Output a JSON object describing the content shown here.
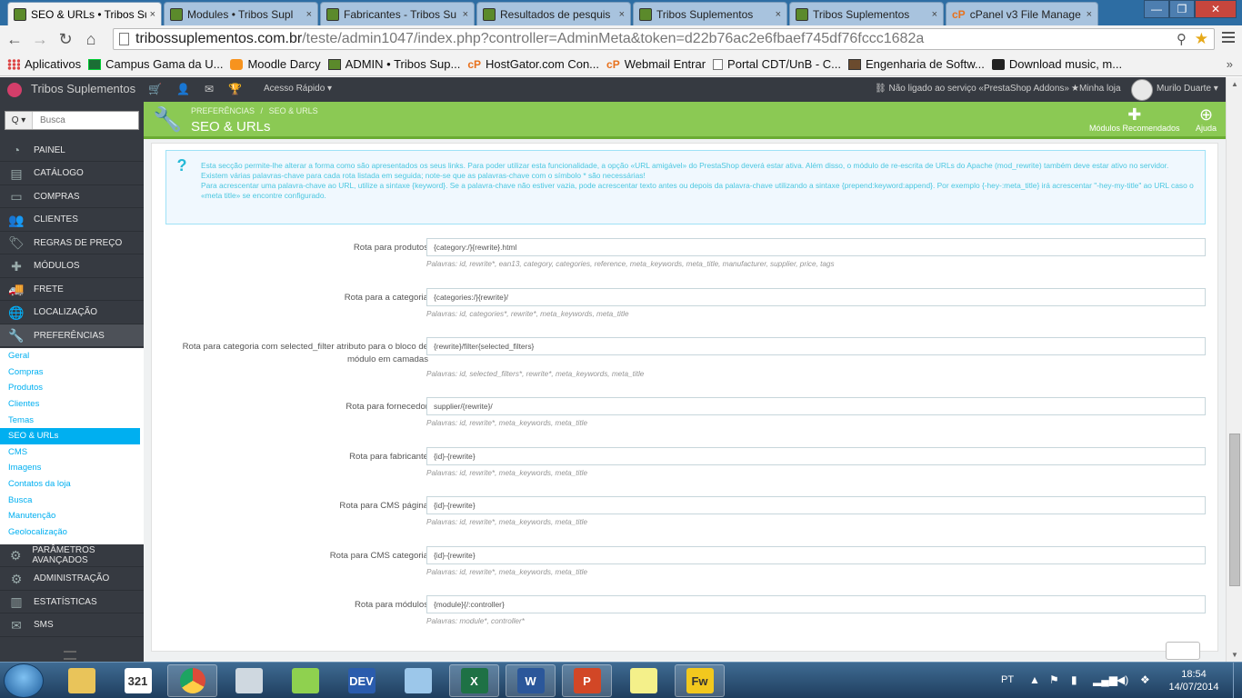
{
  "browser": {
    "tabs": [
      {
        "label": "SEO & URLs • Tribos Su",
        "active": true
      },
      {
        "label": "Modules • Tribos Supl"
      },
      {
        "label": "Fabricantes - Tribos Su"
      },
      {
        "label": "Resultados de pesquis"
      },
      {
        "label": "Tribos Suplementos"
      },
      {
        "label": "Tribos Suplementos"
      },
      {
        "label": "cPanel v3 File Manage"
      }
    ],
    "tab_close": "×",
    "window_controls": {
      "minimize": "—",
      "maximize": "❐",
      "close": "✕"
    },
    "url_host": "tribossuplementos.com.br",
    "url_path": "/teste/admin1047/index.php?controller=AdminMeta&token=d22b76ac2e6fbaef745df76fccc1682a",
    "bookmarks": [
      {
        "label": "Aplicativos",
        "icon": "apps-grid-icon"
      },
      {
        "label": "Campus Gama da U...",
        "icon": "flag-icon"
      },
      {
        "label": "Moodle Darcy",
        "icon": "moodle-icon"
      },
      {
        "label": "ADMIN • Tribos Sup...",
        "icon": "prestashop-icon"
      },
      {
        "label": "HostGator.com Con...",
        "icon": "cpanel-icon"
      },
      {
        "label": "Webmail Entrar",
        "icon": "cpanel-icon"
      },
      {
        "label": "Portal CDT/UnB - C...",
        "icon": "page-icon"
      },
      {
        "label": "Engenharia de Softw...",
        "icon": "image-icon"
      },
      {
        "label": "Download music, m...",
        "icon": "computer-icon"
      }
    ],
    "bookmarks_more": "»"
  },
  "ps_header": {
    "shop_name": "Tribos Suplementos",
    "quick_access": "Acesso Rápido ▾",
    "addons_status": "Não ligado ao serviço «PrestaShop Addons»",
    "my_store": "Minha loja",
    "user_name": "Murilo Duarte ▾"
  },
  "sidebar": {
    "search_placeholder": "Busca",
    "search_button": "Q ▾",
    "menu": [
      {
        "label": "PAINEL",
        "icon": "dashboard-icon"
      },
      {
        "label": "CATÁLOGO",
        "icon": "book-icon"
      },
      {
        "label": "COMPRAS",
        "icon": "credit-card-icon"
      },
      {
        "label": "CLIENTES",
        "icon": "users-icon"
      },
      {
        "label": "REGRAS DE PREÇO",
        "icon": "tag-icon"
      },
      {
        "label": "MÓDULOS",
        "icon": "puzzle-icon"
      },
      {
        "label": "FRETE",
        "icon": "truck-icon"
      },
      {
        "label": "LOCALIZAÇÃO",
        "icon": "globe-icon"
      },
      {
        "label": "PREFERÊNCIAS",
        "icon": "wrench-icon",
        "active": true
      }
    ],
    "submenu": [
      {
        "label": "Geral"
      },
      {
        "label": "Compras"
      },
      {
        "label": "Produtos"
      },
      {
        "label": "Clientes"
      },
      {
        "label": "Temas"
      },
      {
        "label": "SEO & URLs",
        "active": true
      },
      {
        "label": "CMS"
      },
      {
        "label": "Imagens"
      },
      {
        "label": "Contatos da loja"
      },
      {
        "label": "Busca"
      },
      {
        "label": "Manutenção"
      },
      {
        "label": "Geolocalização"
      }
    ],
    "menu_bottom": [
      {
        "label": "PARÂMETROS AVANÇADOS",
        "icon": "cogs-icon"
      },
      {
        "label": "ADMINISTRAÇÃO",
        "icon": "gear-icon"
      },
      {
        "label": "ESTATÍSTICAS",
        "icon": "bar-chart-icon"
      },
      {
        "label": "SMS",
        "icon": "envelope-icon"
      }
    ]
  },
  "page": {
    "breadcrumb_1": "PREFERÊNCIAS",
    "breadcrumb_2": "SEO & URLS",
    "title": "SEO & URLs",
    "recommended_modules": "Módulos Recomendados",
    "help": "Ajuda"
  },
  "alert": {
    "line1": "Esta secção permite-lhe alterar a forma como são apresentados os seus links. Para poder utilizar esta funcionalidade, a opção «URL amigável» do PrestaShop deverá estar ativa. Além disso, o módulo de re-escrita de URLs do Apache (mod_rewrite) também deve estar ativo no servidor.",
    "line2": "Existem várias palavras-chave para cada rota listada em seguida; note-se que as palavras-chave com o símbolo * são necessárias!",
    "line3": "Para acrescentar uma palavra-chave ao URL, utilize a sintaxe {keyword}. Se a palavra-chave não estiver vazia, pode acrescentar texto antes ou depois da palavra-chave utilizando a sintaxe {prepend:keyword:append}. Por exemplo {-hey-:meta_title} irá acrescentar \"-hey-my-title\" ao URL caso o «meta title» se encontre configurado."
  },
  "routes": [
    {
      "label": "Rota para produtos",
      "value": "{category:/}{rewrite}.html",
      "help": "Palavras: id, rewrite*, ean13, category, categories, reference, meta_keywords, meta_title, manufacturer, supplier, price, tags"
    },
    {
      "label": "Rota para a categoria",
      "value": "{categories:/}{rewrite}/",
      "help": "Palavras: id, categories*, rewrite*, meta_keywords, meta_title"
    },
    {
      "label": "Rota para categoria com selected_filter atributo para o bloco de módulo em camadas",
      "value": "{rewrite}/filter{selected_filters}",
      "help": "Palavras: id, selected_filters*, rewrite*, meta_keywords, meta_title"
    },
    {
      "label": "Rota para fornecedor",
      "value": "supplier/{rewrite}/",
      "help": "Palavras: id, rewrite*, meta_keywords, meta_title"
    },
    {
      "label": "Rota para fabricante",
      "value": "{id}-{rewrite}",
      "help": "Palavras: id, rewrite*, meta_keywords, meta_title"
    },
    {
      "label": "Rota para CMS página",
      "value": "{id}-{rewrite}",
      "help": "Palavras: id, rewrite*, meta_keywords, meta_title"
    },
    {
      "label": "Rota para CMS categoria",
      "value": "{id}-{rewrite}",
      "help": "Palavras: id, rewrite*, meta_keywords, meta_title"
    },
    {
      "label": "Rota para módulos",
      "value": "{module}{/:controller}",
      "help": "Palavras: module*, controller*"
    }
  ],
  "taskbar": {
    "apps": [
      {
        "icon": "file-explorer-icon",
        "text": "",
        "color": "#e9c45a"
      },
      {
        "icon": "calendar-icon",
        "text": "321",
        "color": "#ffffff"
      },
      {
        "icon": "chrome-icon",
        "text": "",
        "color": "#dd4b39"
      },
      {
        "icon": "calculator-icon",
        "text": "",
        "color": "#cfd8e0"
      },
      {
        "icon": "notepad-plus-plus-icon",
        "text": "",
        "color": "#8fd14f"
      },
      {
        "icon": "dev-cpp-icon",
        "text": "DEV",
        "color": "#2a5cad"
      },
      {
        "icon": "virtualbox-icon",
        "text": "",
        "color": "#9cc7ea"
      },
      {
        "icon": "excel-icon",
        "text": "X",
        "color": "#1e7145"
      },
      {
        "icon": "word-icon",
        "text": "W",
        "color": "#2b579a"
      },
      {
        "icon": "powerpoint-icon",
        "text": "P",
        "color": "#d24726"
      },
      {
        "icon": "sticky-notes-icon",
        "text": "",
        "color": "#f4f08a"
      },
      {
        "icon": "fireworks-icon",
        "text": "Fw",
        "color": "#f2c81e"
      }
    ],
    "language": "PT",
    "time": "18:54",
    "date": "14/07/2014"
  },
  "colors": {
    "ps_green": "#8bc954",
    "ps_sidebar": "#363a41",
    "ps_blue": "#00aff0",
    "alert_text": "#4ac7e0"
  }
}
